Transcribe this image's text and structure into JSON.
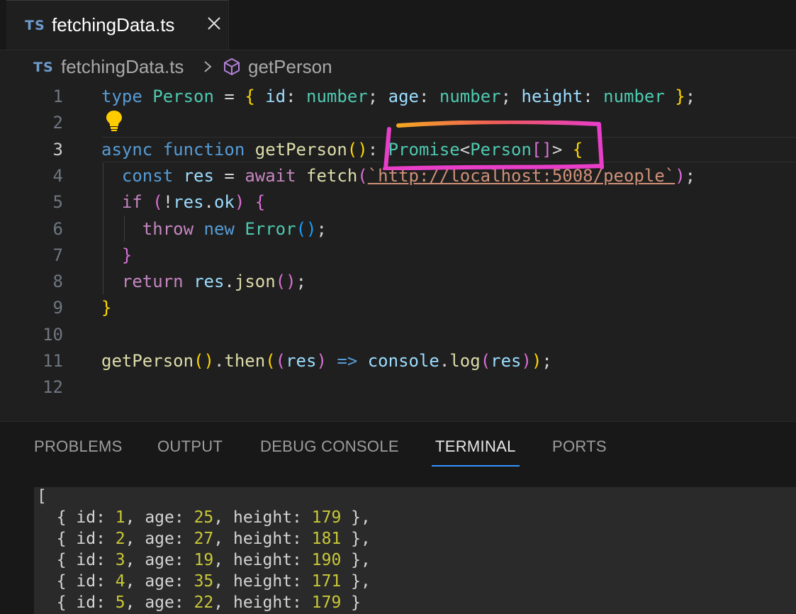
{
  "tab": {
    "icon": "TS",
    "title": "fetchingData.ts"
  },
  "breadcrumb": {
    "icon": "TS",
    "file": "fetchingData.ts",
    "symbol": "getPerson"
  },
  "editor": {
    "line_numbers": [
      "1",
      "2",
      "3",
      "4",
      "5",
      "6",
      "7",
      "8",
      "9",
      "10",
      "11",
      "12"
    ],
    "active_line": "3",
    "lines": [
      [
        [
          "kw",
          "type"
        ],
        [
          "punc",
          " "
        ],
        [
          "typ",
          "Person"
        ],
        [
          "punc",
          " = "
        ],
        [
          "b1",
          "{"
        ],
        [
          "punc",
          " "
        ],
        [
          "var",
          "id"
        ],
        [
          "punc",
          ": "
        ],
        [
          "typ",
          "number"
        ],
        [
          "punc",
          "; "
        ],
        [
          "var",
          "age"
        ],
        [
          "punc",
          ": "
        ],
        [
          "typ",
          "number"
        ],
        [
          "punc",
          "; "
        ],
        [
          "var",
          "height"
        ],
        [
          "punc",
          ": "
        ],
        [
          "typ",
          "number"
        ],
        [
          "punc",
          " "
        ],
        [
          "b1",
          "}"
        ],
        [
          "punc",
          ";"
        ]
      ],
      [],
      [
        [
          "kw",
          "async"
        ],
        [
          "punc",
          " "
        ],
        [
          "kw",
          "function"
        ],
        [
          "punc",
          " "
        ],
        [
          "fn",
          "getPerson"
        ],
        [
          "b1",
          "()"
        ],
        [
          "punc",
          ": "
        ],
        [
          "typ",
          "Promise"
        ],
        [
          "punc",
          "<"
        ],
        [
          "typ",
          "Person"
        ],
        [
          "b2",
          "[]"
        ],
        [
          "punc",
          "> "
        ],
        [
          "b1",
          "{"
        ]
      ],
      [
        [
          "punc",
          "  "
        ],
        [
          "kw",
          "const"
        ],
        [
          "punc",
          " "
        ],
        [
          "var",
          "res"
        ],
        [
          "punc",
          " = "
        ],
        [
          "ctl",
          "await"
        ],
        [
          "punc",
          " "
        ],
        [
          "fn",
          "fetch"
        ],
        [
          "b2",
          "("
        ],
        [
          "str",
          "`http://localhost:5008/people`"
        ],
        [
          "b2",
          ")"
        ],
        [
          "punc",
          ";"
        ]
      ],
      [
        [
          "punc",
          "  "
        ],
        [
          "ctl",
          "if"
        ],
        [
          "punc",
          " "
        ],
        [
          "b2",
          "("
        ],
        [
          "punc",
          "!"
        ],
        [
          "var",
          "res"
        ],
        [
          "punc",
          "."
        ],
        [
          "var",
          "ok"
        ],
        [
          "b2",
          ")"
        ],
        [
          "punc",
          " "
        ],
        [
          "b2",
          "{"
        ]
      ],
      [
        [
          "punc",
          "    "
        ],
        [
          "ctl",
          "throw"
        ],
        [
          "punc",
          " "
        ],
        [
          "kw",
          "new"
        ],
        [
          "punc",
          " "
        ],
        [
          "typ",
          "Error"
        ],
        [
          "b3",
          "()"
        ],
        [
          "punc",
          ";"
        ]
      ],
      [
        [
          "punc",
          "  "
        ],
        [
          "b2",
          "}"
        ]
      ],
      [
        [
          "punc",
          "  "
        ],
        [
          "ctl",
          "return"
        ],
        [
          "punc",
          " "
        ],
        [
          "var",
          "res"
        ],
        [
          "punc",
          "."
        ],
        [
          "fn",
          "json"
        ],
        [
          "b2",
          "()"
        ],
        [
          "punc",
          ";"
        ]
      ],
      [
        [
          "b1",
          "}"
        ]
      ],
      [],
      [
        [
          "fn",
          "getPerson"
        ],
        [
          "b1",
          "()"
        ],
        [
          "punc",
          "."
        ],
        [
          "fn",
          "then"
        ],
        [
          "b1",
          "("
        ],
        [
          "b2",
          "("
        ],
        [
          "var",
          "res"
        ],
        [
          "b2",
          ")"
        ],
        [
          "punc",
          " "
        ],
        [
          "kw",
          "=>"
        ],
        [
          "punc",
          " "
        ],
        [
          "var",
          "console"
        ],
        [
          "punc",
          "."
        ],
        [
          "fn",
          "log"
        ],
        [
          "b2",
          "("
        ],
        [
          "var",
          "res"
        ],
        [
          "b2",
          ")"
        ],
        [
          "b1",
          ")"
        ],
        [
          "punc",
          ";"
        ]
      ],
      []
    ]
  },
  "panel": {
    "tabs": [
      "PROBLEMS",
      "OUTPUT",
      "DEBUG CONSOLE",
      "TERMINAL",
      "PORTS"
    ],
    "active_tab": "TERMINAL"
  },
  "terminal": {
    "open": "[",
    "rows": [
      {
        "id": "1",
        "age": "25",
        "height": "179",
        "tail": " },"
      },
      {
        "id": "2",
        "age": "27",
        "height": "181",
        "tail": " },"
      },
      {
        "id": "3",
        "age": "19",
        "height": "190",
        "tail": " },"
      },
      {
        "id": "4",
        "age": "35",
        "height": "171",
        "tail": " },"
      },
      {
        "id": "5",
        "age": "22",
        "height": "179",
        "tail": " }"
      }
    ]
  },
  "colors": {
    "annotation": "#e83ec8",
    "accent": "#3794ff"
  },
  "icons": [
    "close-icon",
    "chevron-right-icon",
    "symbol-method-icon",
    "lightbulb-icon"
  ]
}
